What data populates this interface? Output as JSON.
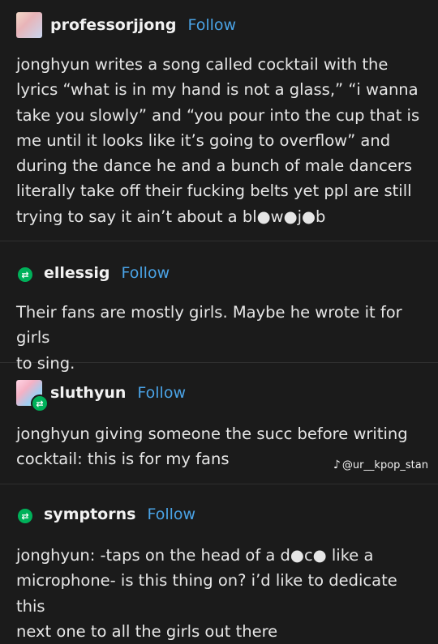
{
  "follow_label": "Follow",
  "posts": [
    {
      "username": "professorjjong",
      "text": "jonghyun writes a song called cocktail with the\nlyrics “what is in my hand is not a glass,” “i wanna\ntake you slowly” and “you pour into the cup that is\nme until it looks like it’s going to overflow” and\nduring the dance he and a bunch of male dancers\nliterally take off their fucking belts yet ppl are still\ntrying to say it ain’t about a bl●w●j●b"
    },
    {
      "username": "ellessig",
      "text": "Their fans are mostly girls. Maybe he wrote it for girls\nto sing."
    },
    {
      "username": "sluthyun",
      "text": "jonghyun giving someone the succ   before writing\ncocktail: this is for my fans"
    },
    {
      "username": "symptorns",
      "text": "jonghyun: -taps on the head of a d●c● like a\nmicrophone- is this thing on? i’d like to dedicate this\nnext one to all the girls out there"
    }
  ],
  "watermark": "@ur__kpop_stan",
  "colors": {
    "background": "#1b1b1b",
    "follow": "#4aa3e6",
    "reblog": "#00b15a"
  }
}
